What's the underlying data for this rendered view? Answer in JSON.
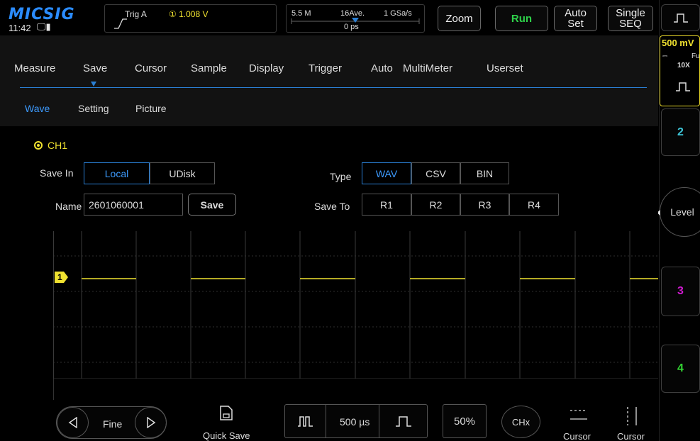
{
  "brand": "MICSIG",
  "status": {
    "time": "11:42",
    "icons": "🖵▮"
  },
  "trigger": {
    "label": "Trig  A",
    "channel_value": "① 1.008 V"
  },
  "timebar": {
    "memory": "5.5 M",
    "average": "16Ave.",
    "rate": "1 GSa/s",
    "position": "0 ps"
  },
  "toolbar": {
    "zoom": "Zoom",
    "run": "Run",
    "autoset_line1": "Auto",
    "autoset_line2": "Set",
    "single_line1": "Single",
    "single_line2": "SEQ"
  },
  "right_panel": {
    "volts": "500 mV",
    "coupling": "Fu",
    "probe": "10X",
    "ch2": "2",
    "level": "Level",
    "ch3": "3",
    "ch4": "4"
  },
  "menu": {
    "tabs": [
      "Measure",
      "Save",
      "Cursor",
      "Sample",
      "Display",
      "Trigger",
      "Auto",
      "MultiMeter",
      "Userset"
    ],
    "active_tab": "Save"
  },
  "subtabs": {
    "items": [
      "Wave",
      "Setting",
      "Picture"
    ],
    "active": "Wave"
  },
  "save_form": {
    "channel": "CH1",
    "save_in_label": "Save In",
    "save_in_options": [
      "Local",
      "UDisk"
    ],
    "save_in_selected": "Local",
    "name_label": "Name",
    "name_value": "2601060001",
    "save_button": "Save",
    "type_label": "Type",
    "type_options": [
      "WAV",
      "CSV",
      "BIN"
    ],
    "type_selected": "WAV",
    "save_to_label": "Save To",
    "save_to_options": [
      "R1",
      "R2",
      "R3",
      "R4"
    ]
  },
  "scope": {
    "channel_marker": "1"
  },
  "bottom": {
    "fine": "Fine",
    "quick_save": "Quick Save",
    "timebase": "500 µs",
    "percent": "50%",
    "chx": "CHx",
    "cursor1": "Cursor",
    "cursor2": "Cursor"
  },
  "colors": {
    "accent": "#2a7fd4",
    "ch1": "#f0e230",
    "ch2": "#3ec6d8",
    "ch3": "#d21ad2",
    "ch4": "#33d633",
    "run": "#2ed24a"
  }
}
